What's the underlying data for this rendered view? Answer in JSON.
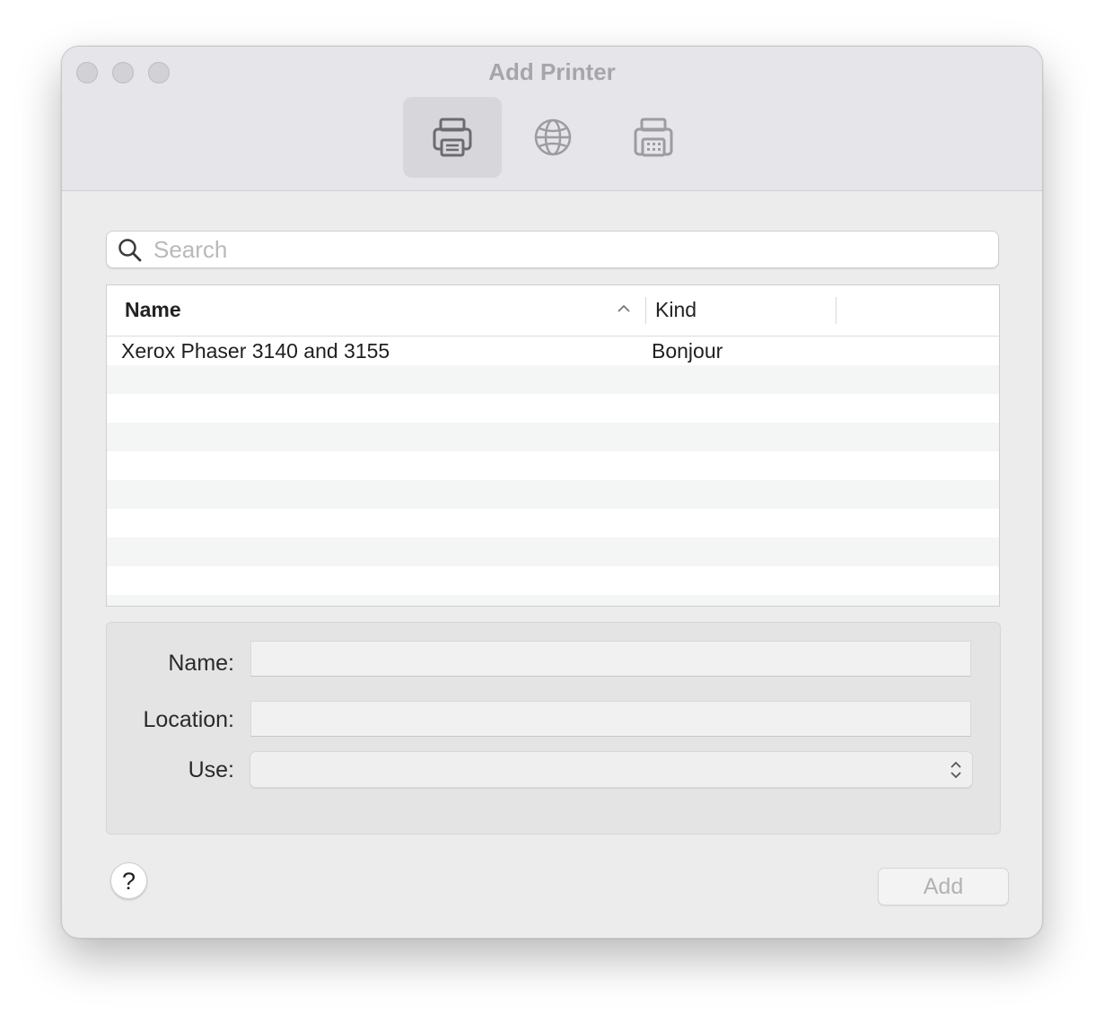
{
  "window": {
    "title": "Add Printer"
  },
  "toolbar": {
    "items": [
      {
        "icon": "printer-icon",
        "selected": true
      },
      {
        "icon": "globe-icon",
        "selected": false
      },
      {
        "icon": "fax-printer-icon",
        "selected": false
      }
    ]
  },
  "search": {
    "placeholder": "Search",
    "value": ""
  },
  "table": {
    "columns": {
      "name": "Name",
      "kind": "Kind",
      "sort": "ascending"
    },
    "rows": [
      {
        "name": "Xerox Phaser 3140 and 3155",
        "kind": "Bonjour"
      }
    ]
  },
  "details": {
    "name_label": "Name:",
    "location_label": "Location:",
    "use_label": "Use:",
    "name_value": "",
    "location_value": "",
    "use_value": ""
  },
  "buttons": {
    "help": "?",
    "add": "Add"
  }
}
